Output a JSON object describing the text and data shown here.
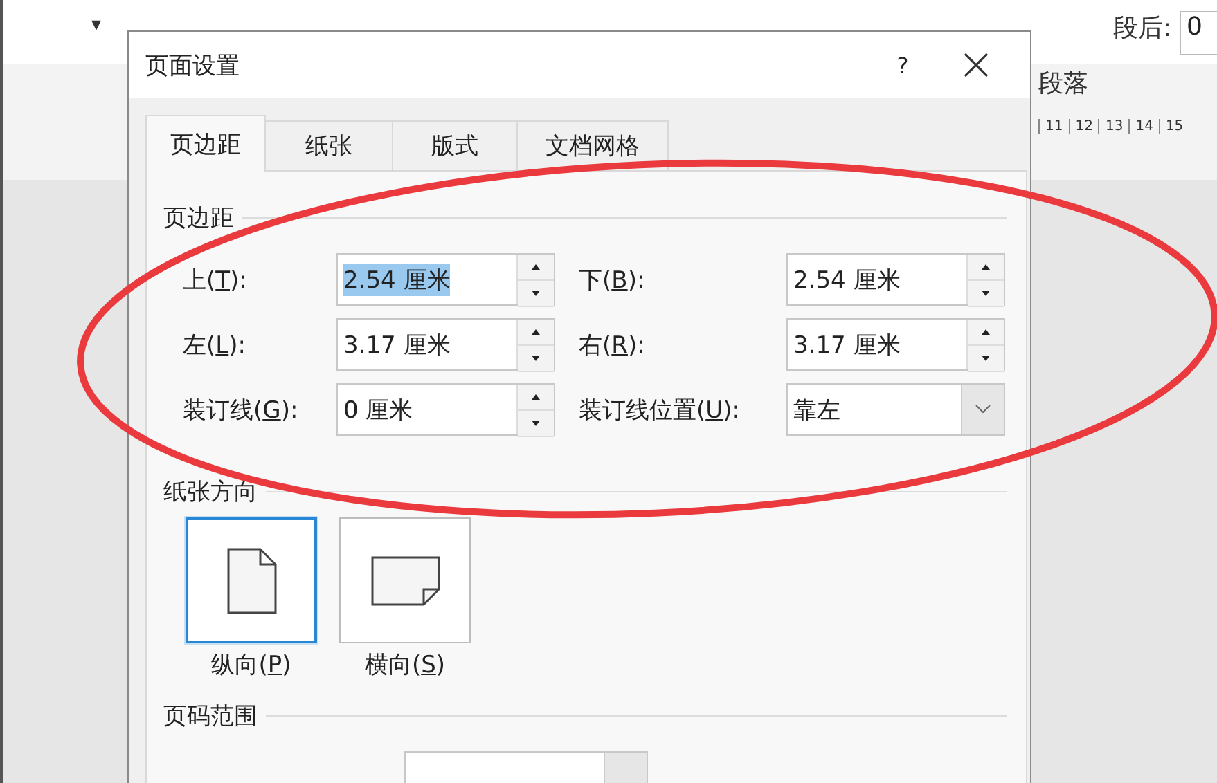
{
  "ribbon": {
    "items": [
      {
        "kind": "caret",
        "text": "▾"
      },
      {
        "kind": "spacing",
        "label": "段后:",
        "value": "0"
      },
      {
        "kind": "group",
        "text": "段落"
      }
    ],
    "ruler": [
      "11",
      "12",
      "13",
      "14",
      "15"
    ]
  },
  "dialog": {
    "title": "页面设置",
    "help": "?",
    "tabs": [
      {
        "label": "页边距",
        "selected": true
      },
      {
        "label": "纸张",
        "selected": false
      },
      {
        "label": "版式",
        "selected": false
      },
      {
        "label": "文档网格",
        "selected": false
      }
    ],
    "margins": {
      "heading": "页边距",
      "fields": [
        {
          "label": "上(T):",
          "value": "2.54 厘米",
          "kind": "spin",
          "selected": true
        },
        {
          "label": "下(B):",
          "value": "2.54 厘米",
          "kind": "spin",
          "selected": false
        },
        {
          "label": "左(L):",
          "value": "3.17 厘米",
          "kind": "spin",
          "selected": false
        },
        {
          "label": "右(R):",
          "value": "3.17 厘米",
          "kind": "spin",
          "selected": false
        },
        {
          "label": "装订线(G):",
          "value": "0 厘米",
          "kind": "spin",
          "selected": false
        },
        {
          "label": "装订线位置(U):",
          "value": "靠左",
          "kind": "dropdown",
          "selected": false
        }
      ]
    },
    "orientation": {
      "heading": "纸张方向",
      "options": [
        {
          "label": "纵向(P)",
          "kind": "portrait",
          "selected": true
        },
        {
          "label": "横向(S)",
          "kind": "landscape",
          "selected": false
        }
      ]
    },
    "pages": {
      "heading": "页码范围",
      "fields": [
        {
          "kind": "dropdown"
        }
      ]
    }
  },
  "annotations": [
    {
      "kind": "ellipse"
    }
  ]
}
